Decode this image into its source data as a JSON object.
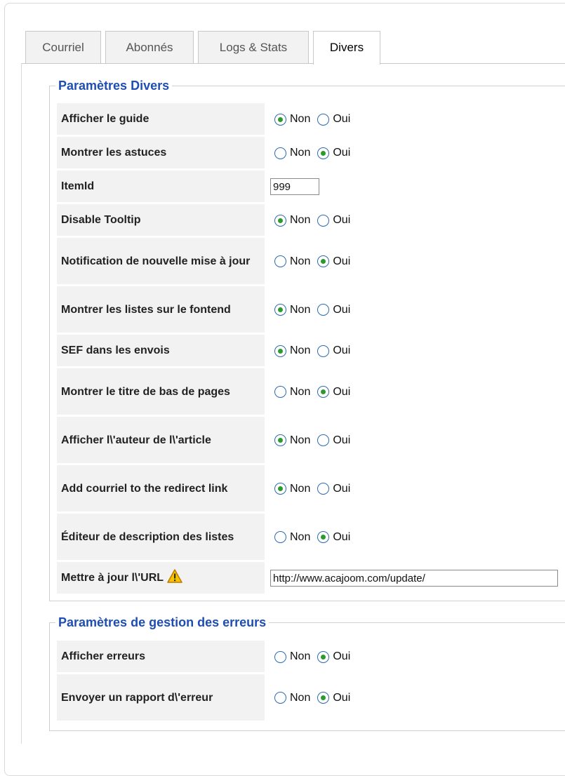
{
  "tabs": [
    {
      "label": "Courriel",
      "active": false
    },
    {
      "label": "Abonnés",
      "active": false
    },
    {
      "label": "Logs & Stats",
      "active": false
    },
    {
      "label": "Divers",
      "active": true
    }
  ],
  "radio_labels": {
    "no": "Non",
    "yes": "Oui"
  },
  "divers": {
    "legend": "Paramètres Divers",
    "rows": [
      {
        "label": "Afficher le guide",
        "type": "radio",
        "value": "Non"
      },
      {
        "label": "Montrer les astuces",
        "type": "radio",
        "value": "Oui"
      },
      {
        "label": "ItemId",
        "type": "text",
        "value": "999"
      },
      {
        "label": "Disable Tooltip",
        "type": "radio",
        "value": "Non"
      },
      {
        "label": "Notification de nouvelle mise à jour",
        "type": "radio",
        "value": "Oui"
      },
      {
        "label": "Montrer les listes sur le fontend",
        "type": "radio",
        "value": "Non"
      },
      {
        "label": "SEF dans les envois",
        "type": "radio",
        "value": "Non"
      },
      {
        "label": "Montrer le titre de bas de pages",
        "type": "radio",
        "value": "Oui"
      },
      {
        "label": "Afficher l\\'auteur de l\\'article",
        "type": "radio",
        "value": "Non"
      },
      {
        "label": "Add courriel to the redirect link",
        "type": "radio",
        "value": "Non"
      },
      {
        "label": "Éditeur de description des listes",
        "type": "radio",
        "value": "Oui"
      },
      {
        "label": "Mettre à jour l\\'URL",
        "type": "text",
        "value": "http://www.acajoom.com/update/",
        "icon": "warning-icon"
      }
    ]
  },
  "errors": {
    "legend": "Paramètres de gestion des erreurs",
    "rows": [
      {
        "label": "Afficher erreurs",
        "type": "radio",
        "value": "Oui"
      },
      {
        "label": "Envoyer un rapport d\\'erreur",
        "type": "radio",
        "value": "Oui"
      }
    ]
  },
  "colors": {
    "legend": "#1e4eb4",
    "label_bg": "#f2f2f2",
    "radio_dot": "#2e9a2e",
    "warning": "#f5c400"
  }
}
